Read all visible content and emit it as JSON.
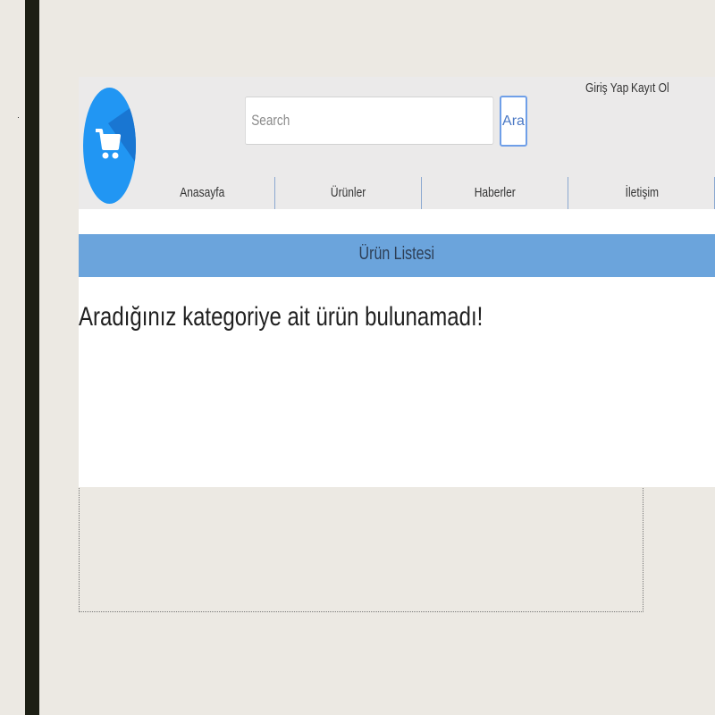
{
  "header": {
    "logo_icon": "shopping-cart-icon",
    "brand_color": "#2196f3",
    "search": {
      "placeholder": "Search",
      "value": "",
      "button_label": "Ara"
    },
    "auth": {
      "login_label": "Giriş Yap",
      "register_label": "Kayıt Ol"
    },
    "nav": [
      {
        "label": "Anasayfa"
      },
      {
        "label": "Ürünler"
      },
      {
        "label": "Haberler"
      },
      {
        "label": "İletişim"
      }
    ]
  },
  "main": {
    "section_title": "Ürün Listesi",
    "section_color": "#6ba4dc",
    "empty_message": "Aradığınız kategoriye ait ürün bulunamadı!"
  }
}
